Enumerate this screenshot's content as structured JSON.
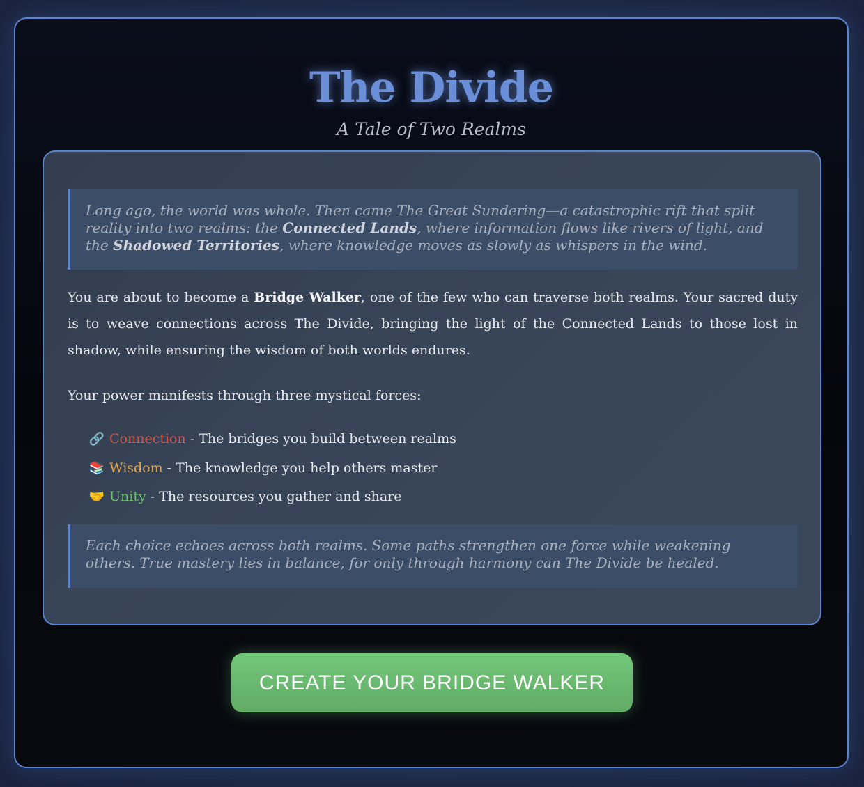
{
  "header": {
    "title": "The Divide",
    "subtitle": "A Tale of Two Realms"
  },
  "intro_quote": {
    "part1": "Long ago, the world was whole. Then came The Great Sundering—a catastrophic rift that split reality into two realms: the ",
    "connected_lands": "Connected Lands",
    "part2": ", where information flows like rivers of light, and the ",
    "shadowed_territories": "Shadowed Territories",
    "part3": ", where knowledge moves as slowly as whispers in the wind."
  },
  "role_paragraph": {
    "before": "You are about to become a ",
    "role": "Bridge Walker",
    "after": ", one of the few who can traverse both realms. Your sacred duty is to weave connections across The Divide, bringing the light of the Connected Lands to those lost in shadow, while ensuring the wisdom of both worlds endures."
  },
  "forces_intro": "Your power manifests through three mystical forces:",
  "forces": [
    {
      "icon": "link-icon",
      "glyph": "🔗",
      "name": "Connection",
      "description": " - The bridges you build between realms",
      "color": "#cf5a4a"
    },
    {
      "icon": "books-icon",
      "glyph": "📚",
      "name": "Wisdom",
      "description": " - The knowledge you help others master",
      "color": "#e0a34a"
    },
    {
      "icon": "handshake-icon",
      "glyph": "🤝",
      "name": "Unity",
      "description": " - The resources you gather and share",
      "color": "#6ebf6e"
    }
  ],
  "closing_quote": "Each choice echoes across both realms. Some paths strengthen one force while weakening others. True mastery lies in balance, for only through harmony can The Divide be healed.",
  "cta": {
    "label": "CREATE YOUR BRIDGE WALKER"
  },
  "colors": {
    "accent": "#5b83cf",
    "title": "#6a8fd8",
    "cta": "#6bbd72"
  }
}
